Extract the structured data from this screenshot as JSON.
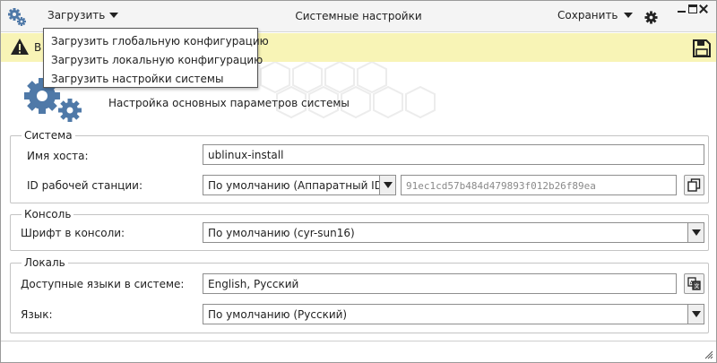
{
  "titlebar": {
    "app_icon": "gears-icon",
    "load_menu_label": "Загрузить",
    "title": "Системные настройки",
    "save_menu_label": "Сохранить",
    "settings_icon": "gear-icon",
    "window_controls": [
      "minimize-icon",
      "maximize-icon",
      "close-icon"
    ]
  },
  "load_menu": {
    "items": [
      "Загрузить глобальную конфигурацию",
      "Загрузить локальную конфигурацию",
      "Загрузить настройки системы"
    ]
  },
  "warning": {
    "icon": "warning-icon",
    "text": "В",
    "save_icon": "floppy-disk-icon"
  },
  "header": {
    "icon": "gears-icon",
    "title": "Настройка основных параметров системы"
  },
  "system_group": {
    "legend": "Система",
    "hostname_label": "Имя хоста:",
    "hostname_value": "ublinux-install",
    "machine_id_label": "ID рабочей станции:",
    "machine_id_selected": "По умолчанию (Аппаратный ID)",
    "machine_id_value": "91ec1cd57b484d479893f012b26f89ea",
    "copy_icon": "copy-icon"
  },
  "console_group": {
    "legend": "Консоль",
    "font_label": "Шрифт в консоли:",
    "font_selected": "По умолчанию (cyr-sun16)"
  },
  "locale_group": {
    "legend": "Локаль",
    "langs_label": "Доступные языки в системе:",
    "langs_value": "English, Русский",
    "translate_icon": "translate-icon",
    "lang_label": "Язык:",
    "lang_selected": "По умолчанию (Русский)"
  },
  "colors": {
    "warning_bg": "#f8f4b6",
    "gear_blue": "#4f79a8",
    "titlebar_bg": "#f4f4f4"
  }
}
